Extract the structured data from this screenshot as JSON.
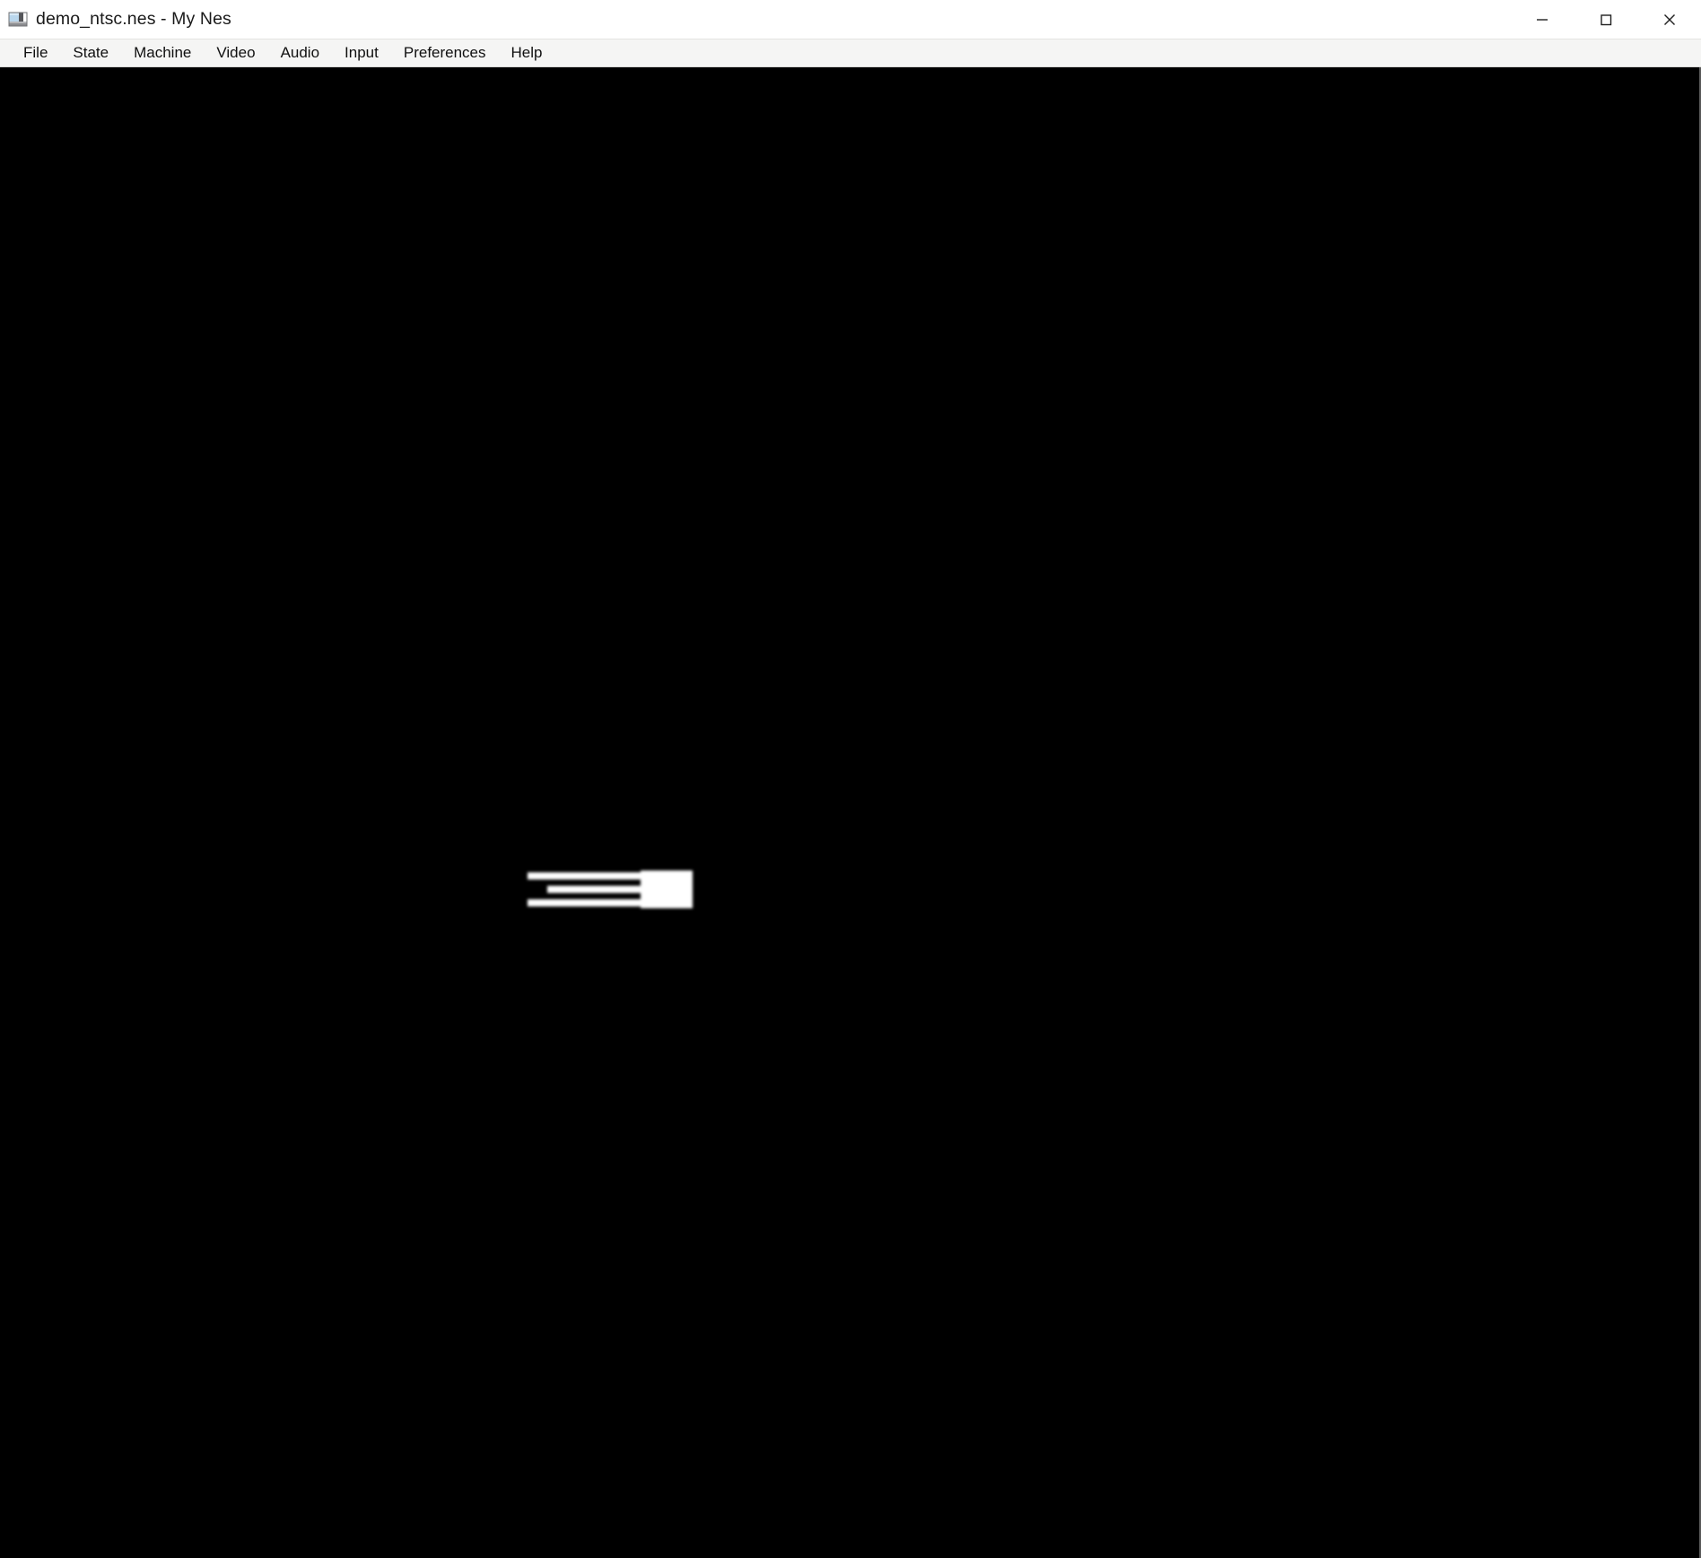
{
  "window": {
    "title": "demo_ntsc.nes - My Nes",
    "icon": "nes-cartridge-icon",
    "controls": [
      {
        "name": "minimize",
        "glyph": "—",
        "label": "Minimize"
      },
      {
        "name": "maximize",
        "glyph": "□",
        "label": "Maximize"
      },
      {
        "name": "close",
        "glyph": "✕",
        "label": "Close"
      }
    ]
  },
  "menubar": {
    "items": [
      {
        "label": "File"
      },
      {
        "label": "State"
      },
      {
        "label": "Machine"
      },
      {
        "label": "Video"
      },
      {
        "label": "Audio"
      },
      {
        "label": "Input"
      },
      {
        "label": "Preferences"
      },
      {
        "label": "Help"
      }
    ]
  },
  "viewport": {
    "name": "emulator-display",
    "background_color": "#000000",
    "sprite_color": "#ffffff",
    "content_description": "NES demo test pattern: three white horizontal bars joined to a solid white rectangle"
  },
  "colors": {
    "titlebar_background": "#ffffff",
    "menubar_background": "#f5f5f4",
    "menubar_border": "#d9d9d7",
    "text": "#101010",
    "screen_background": "#000000",
    "screen_foreground": "#ffffff"
  }
}
